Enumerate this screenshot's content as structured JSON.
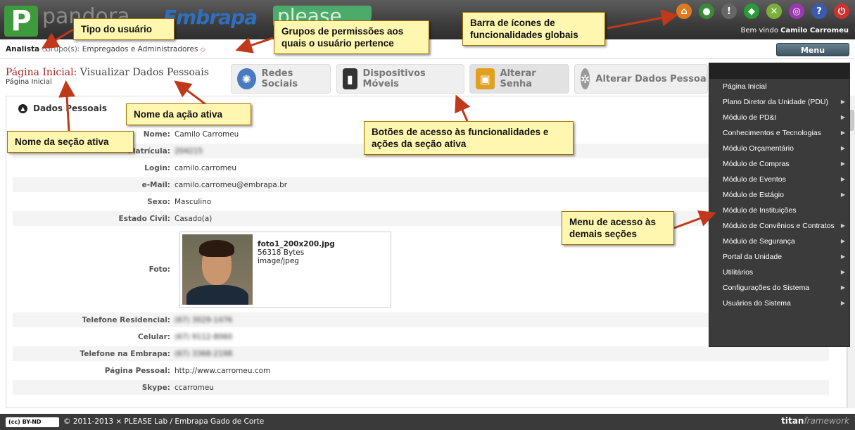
{
  "header": {
    "logo_pandora": "pandora",
    "logo_embrapa": "Embrapa",
    "logo_please": "please",
    "welcome_prefix": "Bem vindo",
    "welcome_user": "Camilo Carromeu",
    "global_icons": [
      {
        "name": "home-icon",
        "glyph": "⌂",
        "color": "#e07a20"
      },
      {
        "name": "user-icon",
        "glyph": "●",
        "color": "#3a8a3a"
      },
      {
        "name": "alert-icon",
        "glyph": "!",
        "color": "#666666"
      },
      {
        "name": "brazil-flag-icon",
        "glyph": "◆",
        "color": "#2a9a3a"
      },
      {
        "name": "tools-icon",
        "glyph": "✕",
        "color": "#7ab03a"
      },
      {
        "name": "plugin-icon",
        "glyph": "◎",
        "color": "#9a3ab0"
      },
      {
        "name": "help-icon",
        "glyph": "?",
        "color": "#3a5ab0"
      },
      {
        "name": "power-icon",
        "glyph": "⏻",
        "color": "#d03030"
      }
    ]
  },
  "infobar": {
    "user_type": "Analista",
    "groups_label": "Grupo(s):",
    "groups_value": "Empregados e Administradores"
  },
  "menu_button": "Menu",
  "page": {
    "section": "Página Inicial:",
    "action": "Visualizar Dados Pessoais",
    "breadcrumb": "Página Inicial"
  },
  "actions": [
    {
      "label": "Redes Sociais",
      "icon": "social-network-icon"
    },
    {
      "label": "Dispositivos Móveis",
      "icon": "mobile-device-icon"
    },
    {
      "label": "Alterar Senha",
      "icon": "padlock-icon"
    },
    {
      "label": "Alterar Dados Pessoais",
      "icon": "gear-icon"
    }
  ],
  "panel": {
    "title": "Dados Pessoais",
    "fields": {
      "nome_label": "Nome:",
      "nome": "Camilo Carromeu",
      "matricula_label": "Matrícula:",
      "matricula": "204215",
      "login_label": "Login:",
      "login": "camilo.carromeu",
      "email_label": "e-Mail:",
      "email": "camilo.carromeu@embrapa.br",
      "sexo_label": "Sexo:",
      "sexo": "Masculino",
      "estado_label": "Estado Civil:",
      "estado": "Casado(a)",
      "foto_label": "Foto:",
      "foto_file": "foto1_200x200.jpg",
      "foto_size": "56318 Bytes",
      "foto_type": "image/jpeg",
      "tel_res_label": "Telefone Residencial:",
      "tel_res": "(67) 3029-1476",
      "celular_label": "Celular:",
      "celular": "(67) 9112-8060",
      "tel_emb_label": "Telefone na Embrapa:",
      "tel_emb": "(67) 3368-2198",
      "pagina_label": "Página Pessoal:",
      "pagina": "http://www.carromeu.com",
      "skype_label": "Skype:",
      "skype": "ccarromeu"
    }
  },
  "sidemenu": [
    {
      "label": "Página Inicial",
      "has_sub": false
    },
    {
      "label": "Plano Diretor da Unidade (PDU)",
      "has_sub": true
    },
    {
      "label": "Módulo de PD&I",
      "has_sub": true
    },
    {
      "label": "Conhecimentos e Tecnologias",
      "has_sub": true
    },
    {
      "label": "Módulo Orçamentário",
      "has_sub": true
    },
    {
      "label": "Módulo de Compras",
      "has_sub": true
    },
    {
      "label": "Módulo de Eventos",
      "has_sub": true
    },
    {
      "label": "Módulo de Estágio",
      "has_sub": true
    },
    {
      "label": "Módulo de Instituições",
      "has_sub": false
    },
    {
      "label": "Módulo de Convênios e Contratos",
      "has_sub": true
    },
    {
      "label": "Módulo de Segurança",
      "has_sub": true
    },
    {
      "label": "Portal da Unidade",
      "has_sub": true
    },
    {
      "label": "Utilitários",
      "has_sub": true
    },
    {
      "label": "Configurações do Sistema",
      "has_sub": true
    },
    {
      "label": "Usuários do Sistema",
      "has_sub": true
    }
  ],
  "footer": {
    "license": "BY-ND",
    "copyright": "© 2011-2013 × PLEASE Lab / Embrapa Gado de Corte",
    "framework_a": "titan",
    "framework_b": "framework"
  },
  "annotations": {
    "tipo_usuario": "Tipo do usuário",
    "grupos": "Grupos de permissões aos quais o usuário pertence",
    "barra_icones": "Barra de ícones de funcionalidades globais",
    "nome_acao": "Nome da ação ativa",
    "nome_secao": "Nome da seção ativa",
    "botoes": "Botões de acesso às funcionalidades e ações da seção ativa",
    "menu_secoes": "Menu de acesso às demais seções"
  },
  "colors": {
    "header_bg": "#3c3c3c",
    "section_title": "#a0262a",
    "callout_bg": "#fff7b0",
    "arrow": "#c0391b",
    "menu_bg": "#3b3b3b"
  }
}
